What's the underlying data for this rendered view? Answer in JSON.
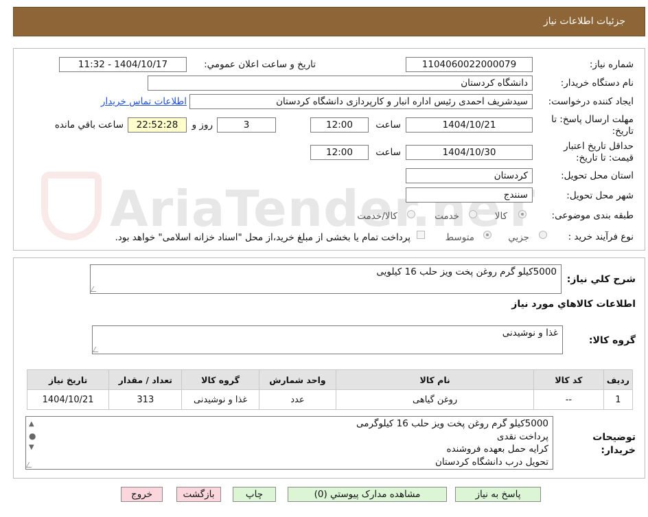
{
  "header": {
    "title": "جزئیات اطلاعات نیاز"
  },
  "fields": {
    "need_number_label": "شماره نیاز:",
    "need_number": "1104060022000079",
    "announce_label": "تاریخ و ساعت اعلان عمومي:",
    "announce_value": "1404/10/17 - 11:32",
    "buyer_org_label": "نام دستگاه خريدار:",
    "buyer_org": "دانشگاه کردستان",
    "requester_label": "ایجاد کننده درخواست:",
    "requester": "سیدشریف احمدی رئیس اداره انبار و کارپردازی دانشگاه کردستان",
    "contact_link": "اطلاعات تماس خریدار",
    "deadline_label": "مهلت ارسال پاسخ: تا تاریخ:",
    "deadline_date": "1404/10/21",
    "time_label": "ساعت",
    "deadline_time": "12:00",
    "days_value": "3",
    "days_label": "روز و",
    "remaining_time": "22:52:28",
    "remaining_label": "ساعت باقي مانده",
    "validity_label": "حداقل تاریخ اعتبار قیمت: تا تاریخ:",
    "validity_date": "1404/10/30",
    "validity_time": "12:00",
    "province_label": "استان محل تحویل:",
    "province": "کردستان",
    "city_label": "شهر محل تحویل:",
    "city": "سنندج",
    "category_label": "طبقه بندی موضوعی:",
    "category_options": [
      "کالا",
      "خدمت",
      "کالا/خدمت"
    ],
    "purchase_type_label": "نوع فرآیند خرید :",
    "purchase_options": [
      "جزیي",
      "متوسط"
    ],
    "purchase_note": "پرداخت تمام یا بخشی از مبلغ خرید،از محل \"اسناد خزانه اسلامی\" خواهد بود."
  },
  "summary": {
    "label": "شرح کلي نياز:",
    "value": "5000کیلو گرم روغن پخت ویز حلب 16 کیلویی"
  },
  "goods_info": {
    "title": "اطلاعات کالاهاي مورد نياز"
  },
  "goods_group": {
    "label": "گروه کالا:",
    "value": "غذا و نوشیدنی"
  },
  "table": {
    "headers": [
      "ردیف",
      "کد کالا",
      "نام کالا",
      "واحد شمارش",
      "گروه کالا",
      "تعداد / مقدار",
      "تاریخ نیاز"
    ],
    "rows": [
      [
        "1",
        "--",
        "روغن گیاهی",
        "عدد",
        "غذا و نوشیدنی",
        "313",
        "1404/10/21"
      ]
    ]
  },
  "buyer_notes": {
    "label": "توضیحات خریدار:",
    "lines": [
      "5000کیلو گرم روغن پخت ویز حلب 16 کیلوگرمی",
      "پرداخت نقدی",
      "کرایه حمل بعهده فروشنده",
      "تحویل درب دانشگاه کردستان"
    ]
  },
  "buttons": {
    "reply": "پاسخ به نیاز",
    "attachments": "مشاهده مدارک پیوستي (0)",
    "print": "چاپ",
    "back": "بازگشت",
    "exit": "خروج"
  },
  "colors": {
    "header_bg": "#8d6536",
    "button_green": "#dcf5d5",
    "button_pink": "#fbd7dd",
    "link": "#1f4fd1",
    "remaining_bg": "#ffffcc"
  }
}
